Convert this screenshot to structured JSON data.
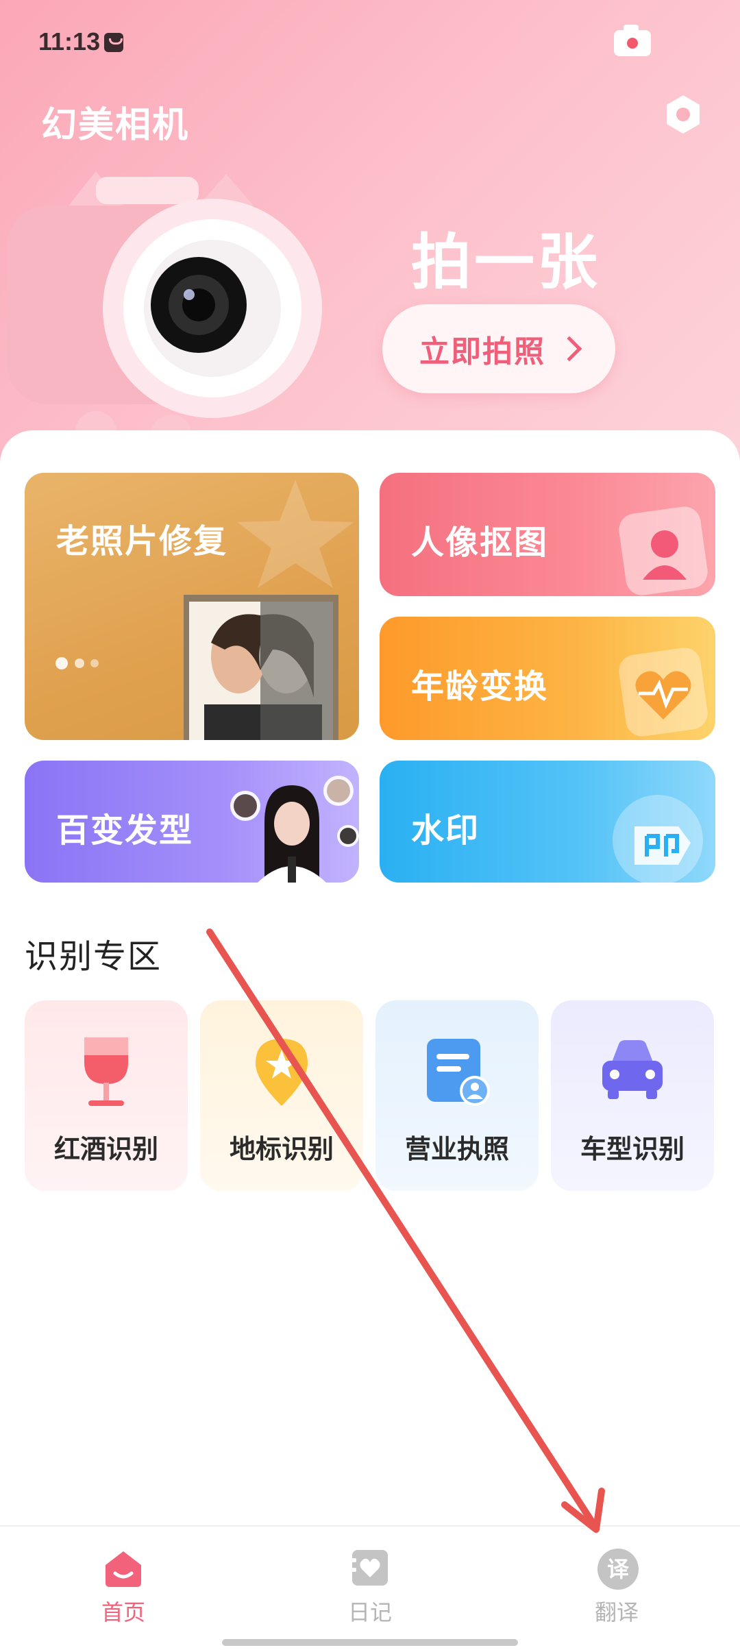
{
  "status_bar": {
    "time": "11:13"
  },
  "header": {
    "app_title": "幻美相机"
  },
  "hero": {
    "title": "拍一张",
    "button_label": "立即拍照"
  },
  "feature_cards": [
    {
      "label": "老照片修复",
      "color_from": "#e9b46a",
      "color_to": "#d99a45"
    },
    {
      "label": "人像抠图",
      "color_from": "#f5707f",
      "color_to": "#fca4ad"
    },
    {
      "label": "年龄变换",
      "color_from": "#fd9a2b",
      "color_to": "#fdd36b"
    },
    {
      "label": "百变发型",
      "color_from": "#8a74f5",
      "color_to": "#c2b3fd"
    },
    {
      "label": "水印",
      "color_from": "#2ab0f2",
      "color_to": "#8fd8fb"
    }
  ],
  "recognition": {
    "title": "识别专区",
    "items": [
      {
        "label": "红酒识别",
        "icon": "wine-glass-icon"
      },
      {
        "label": "地标识别",
        "icon": "landmark-pin-icon"
      },
      {
        "label": "营业执照",
        "icon": "license-card-icon"
      },
      {
        "label": "车型识别",
        "icon": "car-icon"
      }
    ]
  },
  "bottom_nav": {
    "items": [
      {
        "label": "首页",
        "icon": "home-icon",
        "active": true
      },
      {
        "label": "日记",
        "icon": "diary-icon",
        "active": false
      },
      {
        "label": "翻译",
        "icon": "translate-icon",
        "active": false
      }
    ],
    "translate_glyph": "译"
  },
  "colors": {
    "accent": "#ef5f7a",
    "nav_active": "#f2637b",
    "nav_inactive": "#c4c4c4",
    "annotation_arrow": "#e85450"
  }
}
